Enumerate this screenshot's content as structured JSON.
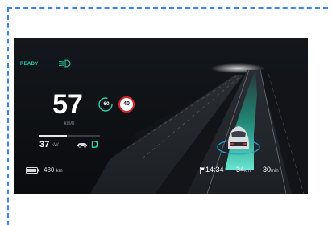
{
  "status": {
    "ready_label": "READY",
    "lights_icon": "low-beam-headlight-icon",
    "accent_color": "#1fd1b0"
  },
  "speed": {
    "value": "57",
    "unit": "km/h"
  },
  "speed_limits": {
    "autopilot_set": "60",
    "road_sign": "40",
    "autopilot_icon": "steering-wheel-ring-icon",
    "sign_color": "#d8232a"
  },
  "power": {
    "value": "37",
    "unit": "kW",
    "bar_fraction": 0.45,
    "car_icon": "car-side-icon",
    "gear": "D"
  },
  "battery": {
    "icon": "battery-icon",
    "range_value": "430",
    "range_unit": "km"
  },
  "navigation": {
    "flag_icon": "destination-flag-icon",
    "arrival_time": "14:34",
    "distance_value": "34",
    "distance_unit": "km",
    "duration_value": "30",
    "duration_unit": "min"
  }
}
